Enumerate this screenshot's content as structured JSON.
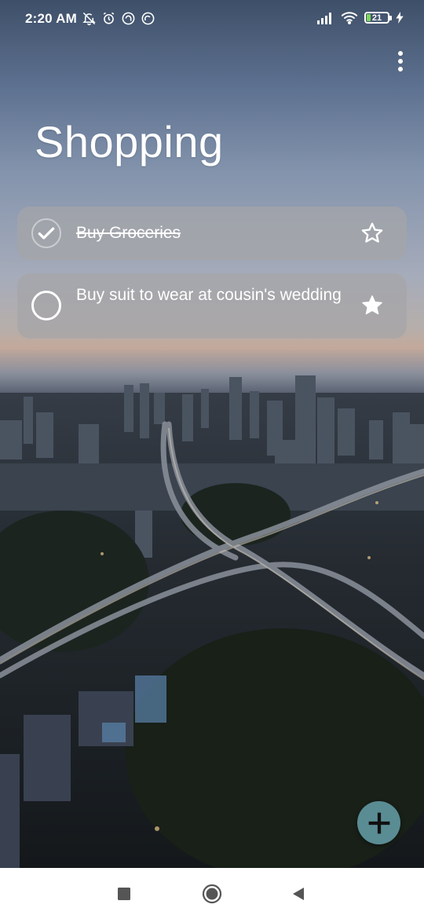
{
  "status_bar": {
    "time": "2:20 AM",
    "battery_level": "21",
    "battery_fraction": 0.21,
    "icons_left": [
      "notifications-muted-icon",
      "alarm-icon",
      "vpn-icon",
      "sync-icon"
    ],
    "icons_right": [
      "signal-icon",
      "wifi-icon",
      "battery-icon",
      "charging-icon"
    ]
  },
  "list": {
    "title": "Shopping"
  },
  "tasks": [
    {
      "text": "Buy Groceries",
      "completed": true,
      "starred": false
    },
    {
      "text": "Buy suit to wear at cousin's wedding",
      "completed": false,
      "starred": true
    }
  ],
  "colors": {
    "fab": "#5a8c93",
    "battery_fill": "#7ed957",
    "task_card": "#a5a5a7"
  },
  "icons": {
    "overflow": "more-vertical-icon",
    "fab": "plus-icon",
    "nav_recents": "square-icon",
    "nav_home": "circle-icon",
    "nav_back": "triangle-back-icon"
  }
}
